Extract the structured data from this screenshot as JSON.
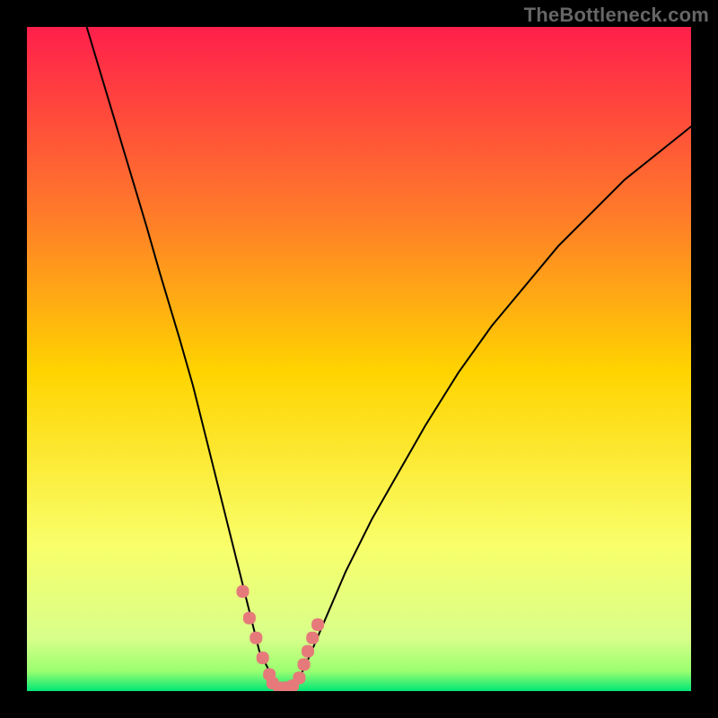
{
  "watermark": "TheBottleneck.com",
  "chart_data": {
    "type": "line",
    "title": "",
    "xlabel": "",
    "ylabel": "",
    "xlim": [
      0,
      100
    ],
    "ylim": [
      0,
      100
    ],
    "grid": false,
    "legend": false,
    "colors": {
      "gradient_top": "#ff1f4b",
      "gradient_mid_upper": "#ff7a2a",
      "gradient_mid": "#ffd400",
      "gradient_lower": "#f9ff6a",
      "gradient_base_upper": "#9bff70",
      "gradient_base": "#00e676",
      "curve": "#000000",
      "marker": "#e67a7a"
    },
    "series": [
      {
        "name": "bottleneck-curve",
        "x": [
          9,
          12,
          15,
          18,
          20,
          23,
          25,
          27,
          29,
          30.5,
          32,
          33.5,
          35,
          36.5,
          38,
          40,
          42,
          45,
          48,
          52,
          56,
          60,
          65,
          70,
          75,
          80,
          85,
          90,
          95,
          100
        ],
        "y": [
          100,
          90,
          80,
          70,
          63,
          53,
          46,
          38,
          30,
          24,
          18,
          12,
          6,
          3,
          0,
          0,
          4,
          11,
          18,
          26,
          33,
          40,
          48,
          55,
          61,
          67,
          72,
          77,
          81,
          85
        ]
      }
    ],
    "markers": {
      "name": "bottom-segment",
      "x": [
        32.5,
        33.5,
        34.5,
        35.5,
        36.5,
        37,
        38,
        39,
        40,
        41,
        41.7,
        42.3,
        43,
        43.8
      ],
      "y": [
        15,
        11,
        8,
        5,
        2.5,
        1.2,
        0.5,
        0.5,
        0.8,
        2,
        4,
        6,
        8,
        10
      ]
    }
  }
}
